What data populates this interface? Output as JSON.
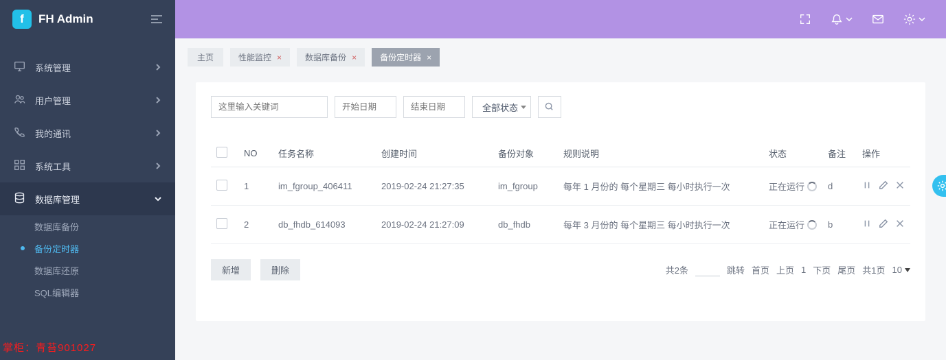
{
  "brand": {
    "logo_letter": "f",
    "title": "FH Admin"
  },
  "sidebar": {
    "items": [
      {
        "label": "系统管理"
      },
      {
        "label": "用户管理"
      },
      {
        "label": "我的通讯"
      },
      {
        "label": "系统工具"
      },
      {
        "label": "数据库管理"
      }
    ],
    "db_children": [
      {
        "label": "数据库备份"
      },
      {
        "label": "备份定时器"
      },
      {
        "label": "数据库还原"
      },
      {
        "label": "SQL编辑器"
      }
    ],
    "shopkeeper": "掌柜：青苔901027"
  },
  "tabs": {
    "home": "主页",
    "items": [
      {
        "label": "性能监控"
      },
      {
        "label": "数据库备份"
      },
      {
        "label": "备份定时器"
      }
    ]
  },
  "filters": {
    "keyword_placeholder": "这里输入关键词",
    "start_placeholder": "开始日期",
    "end_placeholder": "结束日期",
    "status_label": "全部状态"
  },
  "table": {
    "headers": {
      "no": "NO",
      "task": "任务名称",
      "created": "创建时间",
      "target": "备份对象",
      "rule": "规则说明",
      "status": "状态",
      "remark": "备注",
      "ops": "操作"
    },
    "rows": [
      {
        "no": "1",
        "task": "im_fgroup_406411",
        "created": "2019-02-24 21:27:35",
        "target": "im_fgroup",
        "rule": "每年 1 月份的 每个星期三 每小时执行一次",
        "status": "正在运行",
        "remark": "d"
      },
      {
        "no": "2",
        "task": "db_fhdb_614093",
        "created": "2019-02-24 21:27:09",
        "target": "db_fhdb",
        "rule": "每年 3 月份的 每个星期三 每小时执行一次",
        "status": "正在运行",
        "remark": "b"
      }
    ]
  },
  "buttons": {
    "add": "新增",
    "delete": "删除"
  },
  "pager": {
    "total": "共2条",
    "jump": "跳转",
    "first": "首页",
    "prev": "上页",
    "current": "1",
    "next": "下页",
    "last": "尾页",
    "pages": "共1页",
    "pagesize": "10"
  }
}
